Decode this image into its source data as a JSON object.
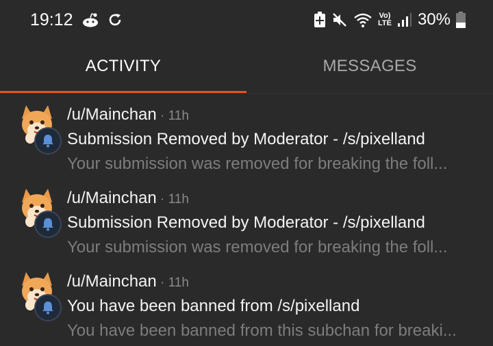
{
  "status_bar": {
    "time": "19:12",
    "lte_top": "Vo)",
    "lte_bottom": "LTE",
    "battery": "30%"
  },
  "tabs": [
    {
      "label": "ACTIVITY",
      "active": true
    },
    {
      "label": "MESSAGES",
      "active": false
    }
  ],
  "notifications": [
    {
      "user": "/u/Mainchan",
      "separator": " · ",
      "time": "11h",
      "title": "Submission Removed by Moderator - /s/pixelland",
      "preview": "Your submission was removed for breaking the foll..."
    },
    {
      "user": "/u/Mainchan",
      "separator": " · ",
      "time": "11h",
      "title": "Submission Removed by Moderator - /s/pixelland",
      "preview": "Your submission was removed for breaking the foll..."
    },
    {
      "user": "/u/Mainchan",
      "separator": " · ",
      "time": "11h",
      "title": "You have been banned from /s/pixelland",
      "preview": "You have been banned from this subchan for breaki..."
    }
  ],
  "colors": {
    "background": "#2a2a2a",
    "accent": "#e8521c",
    "secondary_text": "#7d7d7d"
  }
}
